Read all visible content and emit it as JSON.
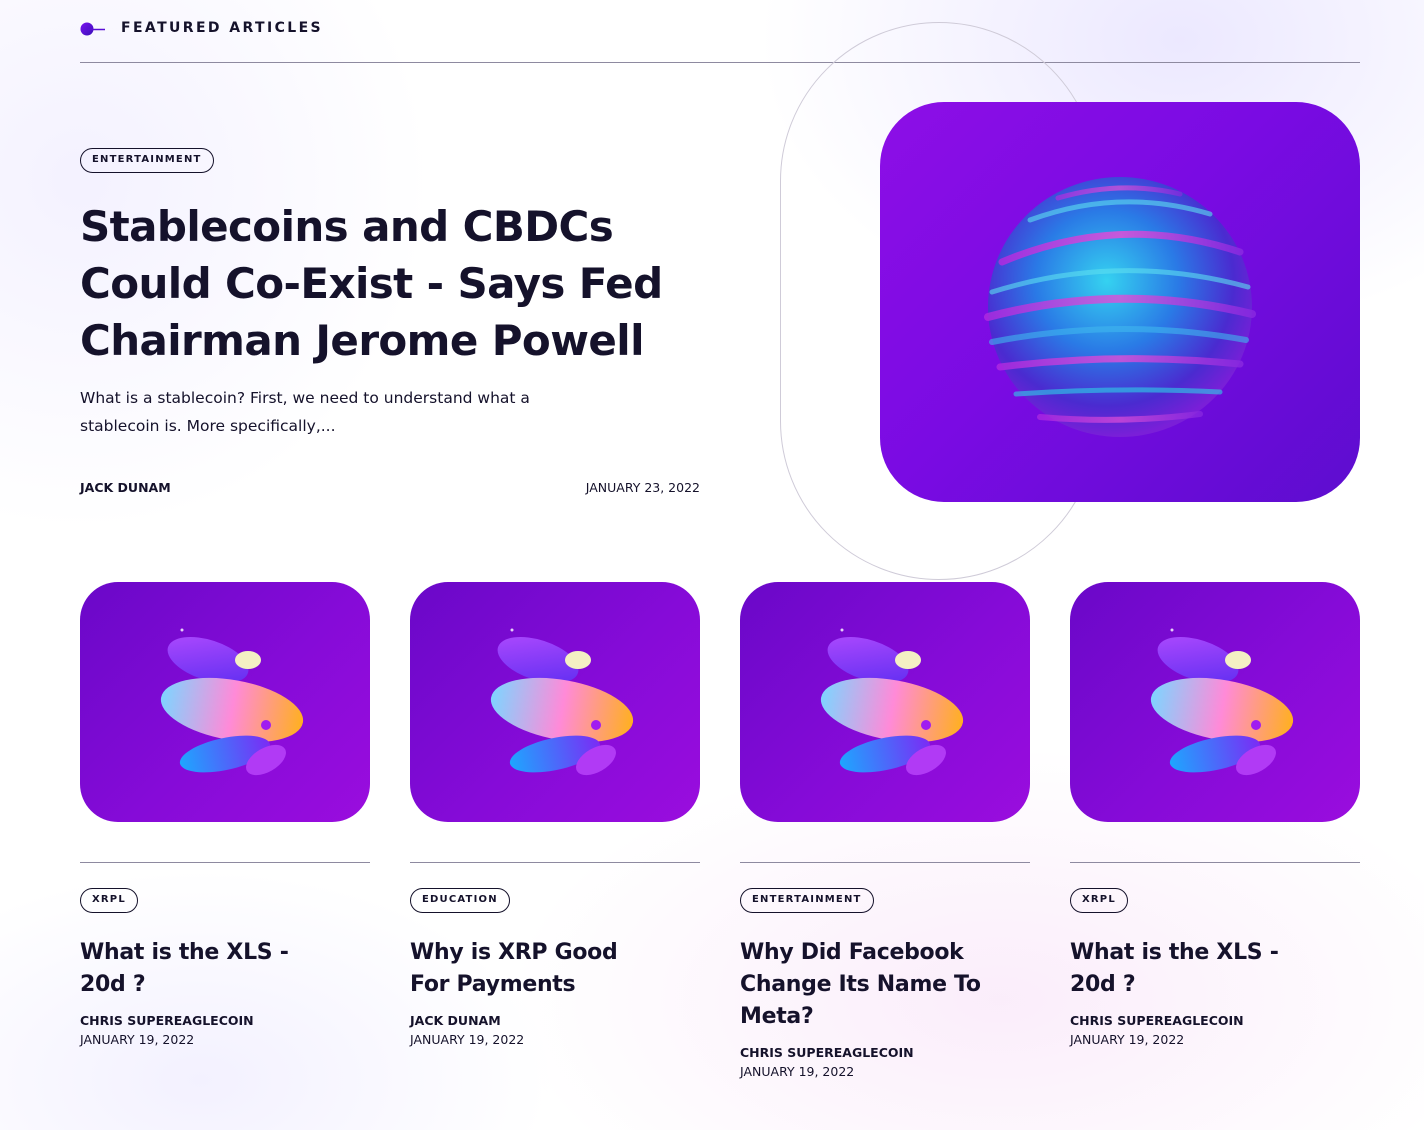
{
  "section": {
    "title": "FEATURED ARTICLES",
    "icon": "planet-orbit-icon",
    "accent_color": "#5a0fd6"
  },
  "featured": {
    "tag": "ENTERTAINMENT",
    "title": "Stablecoins and CBDCs Could Co-Exist - Says Fed Chairman Jerome Powell",
    "excerpt": "What is a stablecoin? First, we need to understand what a stablecoin is. More specifically,...",
    "author": "JACK DUNAM",
    "date": "JANUARY 23, 2022",
    "image": "iridescent-swirl-sphere"
  },
  "cards": [
    {
      "tag": "XRPL",
      "title": "What is the XLS - 20d ?",
      "author": "CHRIS SUPEREAGLECOIN",
      "date": "JANUARY 19, 2022",
      "image": "abstract-3d-shapes"
    },
    {
      "tag": "EDUCATION",
      "title": "Why is XRP Good For Payments",
      "author": "JACK DUNAM",
      "date": "JANUARY 19, 2022",
      "image": "abstract-3d-shapes"
    },
    {
      "tag": "ENTERTAINMENT",
      "title": "Why Did Facebook Change Its Name To Meta?",
      "author": "CHRIS SUPEREAGLECOIN",
      "date": "JANUARY 19, 2022",
      "image": "abstract-3d-shapes"
    },
    {
      "tag": "XRPL",
      "title": "What is the XLS - 20d ?",
      "author": "CHRIS SUPEREAGLECOIN",
      "date": "JANUARY 19, 2022",
      "image": "abstract-3d-shapes"
    }
  ]
}
